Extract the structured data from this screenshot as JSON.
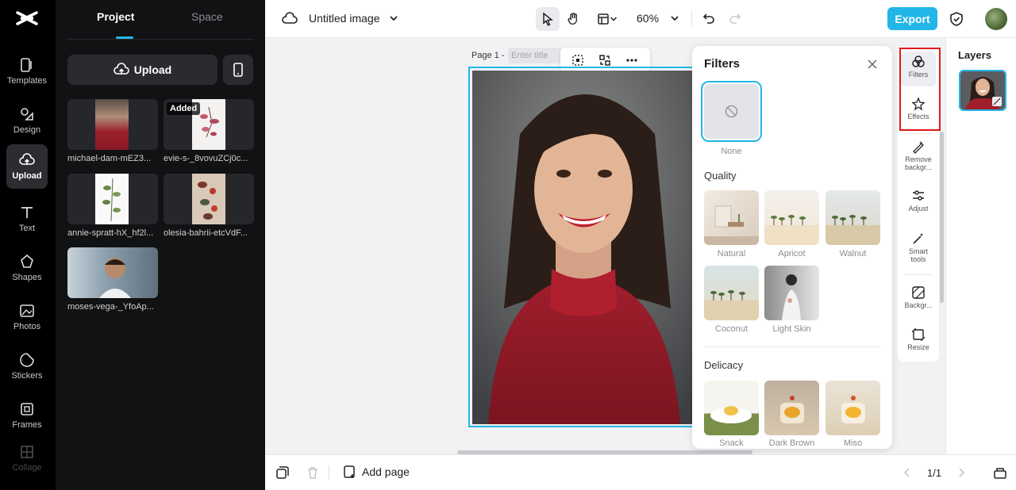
{
  "rail": {
    "items": [
      {
        "label": "Templates",
        "icon": "templates-icon"
      },
      {
        "label": "Design",
        "icon": "design-icon"
      },
      {
        "label": "Upload",
        "icon": "upload-cloud-icon",
        "active": true
      },
      {
        "label": "Text",
        "icon": "text-icon"
      },
      {
        "label": "Shapes",
        "icon": "shapes-icon"
      },
      {
        "label": "Photos",
        "icon": "photos-icon"
      },
      {
        "label": "Stickers",
        "icon": "stickers-icon"
      },
      {
        "label": "Frames",
        "icon": "frames-icon"
      },
      {
        "label": "Collage",
        "icon": "collage-icon"
      }
    ]
  },
  "panel": {
    "tabs": [
      "Project",
      "Space"
    ],
    "upload_label": "Upload",
    "added_badge": "Added",
    "assets": [
      "michael-dam-mEZ3...",
      "evie-s-_8vovuZCj0c...",
      "annie-spratt-hX_hf2l...",
      "olesia-bahrii-etcVdF...",
      "moses-vega-_YfoAp..."
    ]
  },
  "topbar": {
    "title": "Untitled image",
    "zoom": "60%",
    "export_label": "Export"
  },
  "canvas": {
    "page_label": "Page 1 -",
    "title_placeholder": "Enter title"
  },
  "filters": {
    "title": "Filters",
    "none_label": "None",
    "quality_heading": "Quality",
    "quality": [
      "Natural",
      "Apricot",
      "Walnut",
      "Coconut",
      "Light Skin"
    ],
    "delicacy_heading": "Delicacy",
    "delicacy": [
      "Snack",
      "Dark Brown",
      "Miso"
    ]
  },
  "strip": {
    "items": [
      {
        "label": "Filters",
        "icon": "filters-icon",
        "active": true
      },
      {
        "label": "Effects",
        "icon": "effects-icon"
      },
      {
        "label": "Remove backgr...",
        "icon": "remove-background-icon"
      },
      {
        "label": "Adjust",
        "icon": "adjust-icon"
      },
      {
        "label": "Smart tools",
        "icon": "smart-tools-icon"
      },
      {
        "label": "Backgr...",
        "icon": "background-icon"
      },
      {
        "label": "Resize",
        "icon": "resize-icon"
      }
    ]
  },
  "layers": {
    "title": "Layers"
  },
  "bottombar": {
    "add_page_label": "Add page",
    "pager": "1/1"
  },
  "colors": {
    "accent": "#22b6e8",
    "highlight_box": "#e01818",
    "sidebar_bg": "#000000",
    "panel_bg": "#111214"
  }
}
